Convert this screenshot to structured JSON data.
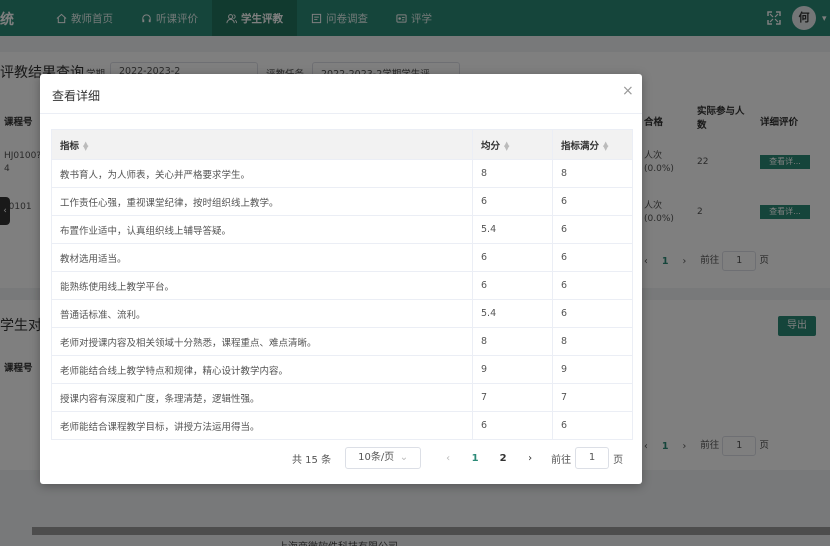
{
  "app": {
    "brand_partial": "统"
  },
  "nav": [
    {
      "label": "教师首页",
      "icon": "home-icon"
    },
    {
      "label": "听课评价",
      "icon": "headphones-icon"
    },
    {
      "label": "学生评教",
      "icon": "users-icon",
      "active": true
    },
    {
      "label": "问卷调查",
      "icon": "survey-icon"
    },
    {
      "label": "评学",
      "icon": "grade-icon"
    }
  ],
  "user": {
    "avatar_text": "何"
  },
  "background": {
    "section1_title": "评教结果查询",
    "term_label": "学期",
    "term_value": "2022-2023-2",
    "task_label": "评教任务",
    "task_value": "2022-2023-2学期学生评",
    "col_course_no": "课程号",
    "col_pass": "合格",
    "col_actual": "实际参与人数",
    "col_detail": "详细评价",
    "rows": [
      {
        "course_no": "HJ0100?4",
        "pass": "人次(0.0%)",
        "actual": "22",
        "detail": "查看详..."
      },
      {
        "course_no": "J0101",
        "pass": "人次(0.0%)",
        "actual": "2",
        "detail": "查看详..."
      }
    ],
    "section2_title": "学生对",
    "export_label": "导出",
    "goto_label": "前往",
    "page_current": "1",
    "page_input": "1",
    "page_unit": "页",
    "footer_text": "上海商微软件科技有限公司"
  },
  "dialog": {
    "title": "查看详细",
    "close_label": "×",
    "columns": [
      "指标",
      "均分",
      "指标满分"
    ],
    "rows": [
      [
        "教书育人，为人师表，关心并严格要求学生。",
        "8",
        "8"
      ],
      [
        "工作责任心强，重视课堂纪律，按时组织线上教学。",
        "6",
        "6"
      ],
      [
        "布置作业适中，认真组织线上辅导答疑。",
        "5.4",
        "6"
      ],
      [
        "教材选用适当。",
        "6",
        "6"
      ],
      [
        "能熟练使用线上教学平台。",
        "6",
        "6"
      ],
      [
        "普通话标准、流利。",
        "5.4",
        "6"
      ],
      [
        "老师对授课内容及相关领域十分熟悉，课程重点、难点清晰。",
        "8",
        "8"
      ],
      [
        "老师能结合线上教学特点和规律，精心设计教学内容。",
        "9",
        "9"
      ],
      [
        "授课内容有深度和广度，条理清楚，逻辑性强。",
        "7",
        "7"
      ],
      [
        "老师能结合课程教学目标，讲授方法运用得当。",
        "6",
        "6"
      ]
    ],
    "pagination": {
      "total": "共 15 条",
      "page_size": "10条/页",
      "pages": [
        "1",
        "2"
      ],
      "current": "1",
      "goto_label": "前往",
      "goto_value": "1",
      "page_unit": "页"
    }
  }
}
